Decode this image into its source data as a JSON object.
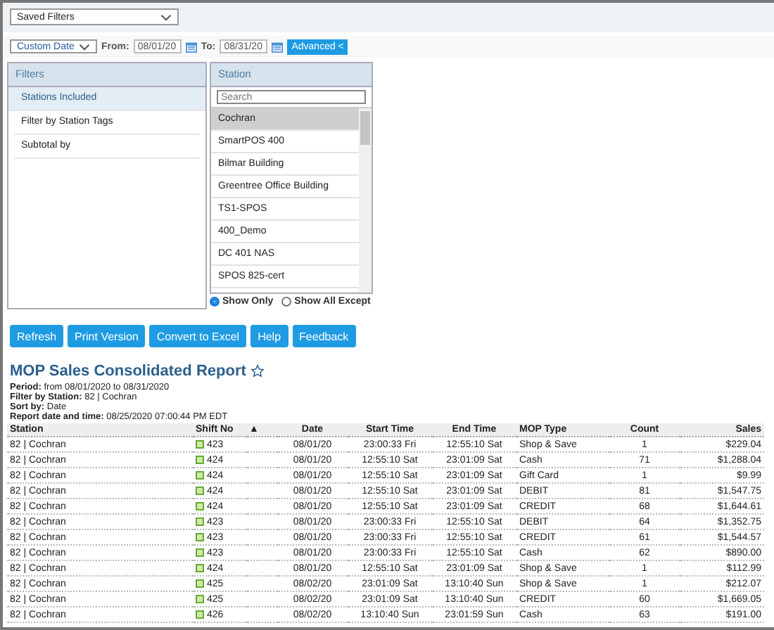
{
  "saved_filters": {
    "label": "Saved Filters"
  },
  "date_range": {
    "value": "Custom Date",
    "from_label": "From:",
    "from": "08/01/20",
    "to_label": "To:",
    "to": "08/31/20",
    "advanced_button": "Advanced <"
  },
  "filters": {
    "title": "Filters",
    "items": [
      {
        "label": "Stations Included",
        "selected": true
      },
      {
        "label": "Filter by Station Tags",
        "selected": false
      },
      {
        "label": "Subtotal by",
        "selected": false
      }
    ]
  },
  "station": {
    "title": "Station",
    "search_placeholder": "Search",
    "items": [
      {
        "label": "Cochran",
        "selected": true
      },
      {
        "label": "SmartPOS 400",
        "selected": false
      },
      {
        "label": "Bilmar Building",
        "selected": false
      },
      {
        "label": "Greentree Office Building",
        "selected": false
      },
      {
        "label": "TS1-SPOS",
        "selected": false
      },
      {
        "label": "400_Demo",
        "selected": false
      },
      {
        "label": "DC 401 NAS",
        "selected": false
      },
      {
        "label": "SPOS 825-cert",
        "selected": false
      }
    ],
    "options": [
      {
        "label": "Show Only",
        "selected": true
      },
      {
        "label": "Show All Except",
        "selected": false
      }
    ]
  },
  "buttons": [
    "Refresh",
    "Print Version",
    "Convert to Excel",
    "Help",
    "Feedback"
  ],
  "report": {
    "title": "MOP Sales Consolidated Report",
    "meta": [
      {
        "label": "Period:",
        "value": "from 08/01/2020 to 08/31/2020"
      },
      {
        "label": "Filter by Station:",
        "value": "82 | Cochran"
      },
      {
        "label": "Sort by:",
        "value": "Date"
      },
      {
        "label": "Report date and time:",
        "value": "08/25/2020 07:00:44 PM EDT"
      }
    ]
  },
  "table": {
    "columns": [
      "Station",
      "Shift No",
      "Date",
      "Start Time",
      "End Time",
      "MOP Type",
      "Count",
      "Sales"
    ],
    "sort_indicator": "▲",
    "rows": [
      [
        "82 | Cochran",
        "423",
        "08/01/20",
        "23:00:33 Fri",
        "12:55:10 Sat",
        "Shop & Save",
        "1",
        "$229.04"
      ],
      [
        "82 | Cochran",
        "424",
        "08/01/20",
        "12:55:10 Sat",
        "23:01:09 Sat",
        "Cash",
        "71",
        "$1,288.04"
      ],
      [
        "82 | Cochran",
        "424",
        "08/01/20",
        "12:55:10 Sat",
        "23:01:09 Sat",
        "Gift Card",
        "1",
        "$9.99"
      ],
      [
        "82 | Cochran",
        "424",
        "08/01/20",
        "12:55:10 Sat",
        "23:01:09 Sat",
        "DEBIT",
        "81",
        "$1,547.75"
      ],
      [
        "82 | Cochran",
        "424",
        "08/01/20",
        "12:55:10 Sat",
        "23:01:09 Sat",
        "CREDIT",
        "68",
        "$1,644.61"
      ],
      [
        "82 | Cochran",
        "423",
        "08/01/20",
        "23:00:33 Fri",
        "12:55:10 Sat",
        "DEBIT",
        "64",
        "$1,352.75"
      ],
      [
        "82 | Cochran",
        "423",
        "08/01/20",
        "23:00:33 Fri",
        "12:55:10 Sat",
        "CREDIT",
        "61",
        "$1,544.57"
      ],
      [
        "82 | Cochran",
        "423",
        "08/01/20",
        "23:00:33 Fri",
        "12:55:10 Sat",
        "Cash",
        "62",
        "$890.00"
      ],
      [
        "82 | Cochran",
        "424",
        "08/01/20",
        "12:55:10 Sat",
        "23:01:09 Sat",
        "Shop & Save",
        "1",
        "$112.99"
      ],
      [
        "82 | Cochran",
        "425",
        "08/02/20",
        "23:01:09 Sat",
        "13:10:40 Sun",
        "Shop & Save",
        "1",
        "$212.07"
      ],
      [
        "82 | Cochran",
        "425",
        "08/02/20",
        "23:01:09 Sat",
        "13:10:40 Sun",
        "CREDIT",
        "60",
        "$1,669.05"
      ],
      [
        "82 | Cochran",
        "426",
        "08/02/20",
        "13:10:40 Sun",
        "23:01:59 Sun",
        "Cash",
        "63",
        "$191.00"
      ]
    ]
  }
}
